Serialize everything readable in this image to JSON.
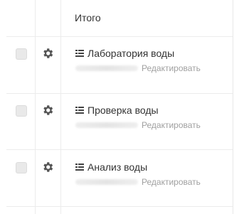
{
  "header": {
    "total_label": "Итого"
  },
  "rows": [
    {
      "name": "Лаборатория воды",
      "edit_label": "Редактировать"
    },
    {
      "name": "Проверка воды",
      "edit_label": "Редактировать"
    },
    {
      "name": "Анализ воды",
      "edit_label": "Редактировать"
    }
  ]
}
